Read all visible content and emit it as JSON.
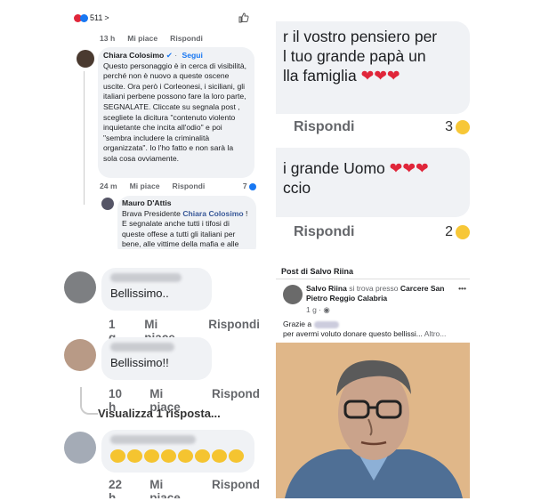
{
  "top_left": {
    "reaction_count": "511",
    "reaction_chevron": ">",
    "comment1_time": "13 h",
    "like_label": "Mi piace",
    "reply_label": "Rispondi",
    "comment2": {
      "author": "Chiara Colosimo",
      "verified_badge": "✔",
      "follow": "Segui",
      "text": "Questo personaggio è in cerca di visibilità, perché non è nuovo a queste oscene uscite. Ora però i Corleonesi, i siciliani, gli italiani perbene possono fare la loro parte, SEGNALATE. Cliccate su segnala post , scegliete la dicitura \"contenuto violento inquietante che incita all'odio\" e poi \"sembra includere la criminalità organizzata\". Io l'ho fatto e non sarà la sola cosa ovviamente.",
      "time": "24 m",
      "reaction_count": "7"
    },
    "reply": {
      "author": "Mauro D'Attis",
      "text_before": "Brava Presidente ",
      "tag": "Chiara Colosimo",
      "text_after": " ! E segnalate anche tutti i tifosi di queste offese a tutti gli italiani per bene, alle vittime della mafia e alle loro famiglie."
    }
  },
  "top_right": {
    "c1_line1": "r il vostro pensiero per",
    "c1_line2": "l tuo grande papà un",
    "c1_line3": "lla famiglia",
    "hearts": "❤❤❤",
    "reply_label": "Rispondi",
    "c1_reactions": "3",
    "c2_line1": "i grande Uomo",
    "c2_line2": "ccio",
    "c2_reactions": "2"
  },
  "bottom_left": {
    "comments": [
      {
        "name_fragment": "",
        "text": "Bellissimo..",
        "time": "1 g",
        "like": "Mi piace",
        "reply": "Rispondi"
      },
      {
        "name_fragment": "",
        "text": "Bellissimo!!",
        "time": "10 h",
        "like": "Mi piace",
        "reply": "Rispond"
      },
      {
        "name_fragment": "",
        "text": "",
        "time": "22 h",
        "like": "Mi piace",
        "reply": "Rispond"
      }
    ],
    "view_replies": "Visualizza 1 risposta...",
    "clap_count": 8
  },
  "bottom_right": {
    "header": "Post di Salvo Riina",
    "author": "Salvo Riina",
    "location_text": " si trova presso ",
    "location": "Carcere San Pietro Reggio Calabria",
    "more": "•••",
    "time": "1 g ·",
    "caption_line1": "Grazie a",
    "caption_line2": "per avermi voluto donare questo bellissi...",
    "caption_more": "Altro..."
  },
  "colors": {
    "accent": "#1877f2",
    "heart": "#e0263a",
    "bubble": "#f0f2f5"
  }
}
